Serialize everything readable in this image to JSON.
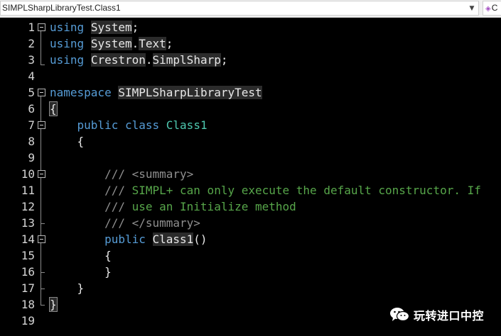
{
  "navbar": {
    "type_selector": "SIMPLSharpLibraryTest.Class1",
    "member_selector": "C"
  },
  "editor": {
    "lines": [
      {
        "n": "1",
        "tokens": [
          {
            "t": "using",
            "c": "kw"
          },
          {
            "t": " "
          },
          {
            "t": "System",
            "c": "hl"
          },
          {
            "t": ";"
          }
        ]
      },
      {
        "n": "2",
        "tokens": [
          {
            "t": "using",
            "c": "kw"
          },
          {
            "t": " "
          },
          {
            "t": "System",
            "c": "hl"
          },
          {
            "t": "."
          },
          {
            "t": "Text",
            "c": "hl"
          },
          {
            "t": ";"
          }
        ]
      },
      {
        "n": "3",
        "tokens": [
          {
            "t": "using",
            "c": "kw"
          },
          {
            "t": " "
          },
          {
            "t": "Crestron",
            "c": "hl"
          },
          {
            "t": "."
          },
          {
            "t": "SimplSharp",
            "c": "hl"
          },
          {
            "t": ";"
          }
        ]
      },
      {
        "n": "4",
        "tokens": []
      },
      {
        "n": "5",
        "tokens": [
          {
            "t": "namespace",
            "c": "kw"
          },
          {
            "t": " "
          },
          {
            "t": "SIMPLSharpLibraryTest",
            "c": "hl"
          }
        ]
      },
      {
        "n": "6",
        "tokens": [
          {
            "t": "{",
            "c": "brace-hl"
          }
        ]
      },
      {
        "n": "7",
        "tokens": [
          {
            "t": "    "
          },
          {
            "t": "public",
            "c": "kw"
          },
          {
            "t": " "
          },
          {
            "t": "class",
            "c": "kw"
          },
          {
            "t": " "
          },
          {
            "t": "Class1",
            "c": "ty"
          }
        ]
      },
      {
        "n": "8",
        "tokens": [
          {
            "t": "    {"
          }
        ]
      },
      {
        "n": "9",
        "tokens": []
      },
      {
        "n": "10",
        "tokens": [
          {
            "t": "        "
          },
          {
            "t": "/// <summary>",
            "c": "cmg"
          }
        ]
      },
      {
        "n": "11",
        "tokens": [
          {
            "t": "        "
          },
          {
            "t": "/// ",
            "c": "cmg"
          },
          {
            "t": "SIMPL+ can only execute the default constructor. If",
            "c": "cm"
          }
        ]
      },
      {
        "n": "12",
        "tokens": [
          {
            "t": "        "
          },
          {
            "t": "/// ",
            "c": "cmg"
          },
          {
            "t": "use an Initialize method",
            "c": "cm"
          }
        ]
      },
      {
        "n": "13",
        "tokens": [
          {
            "t": "        "
          },
          {
            "t": "/// </summary>",
            "c": "cmg"
          }
        ]
      },
      {
        "n": "14",
        "tokens": [
          {
            "t": "        "
          },
          {
            "t": "public",
            "c": "kw"
          },
          {
            "t": " "
          },
          {
            "t": "Class1",
            "c": "hl"
          },
          {
            "t": "()"
          }
        ]
      },
      {
        "n": "15",
        "tokens": [
          {
            "t": "        {"
          }
        ]
      },
      {
        "n": "16",
        "tokens": [
          {
            "t": "        }"
          }
        ]
      },
      {
        "n": "17",
        "tokens": [
          {
            "t": "    }"
          }
        ]
      },
      {
        "n": "18",
        "tokens": [
          {
            "t": "}",
            "c": "brace-hl"
          }
        ]
      },
      {
        "n": "19",
        "tokens": []
      }
    ]
  },
  "watermark": {
    "text": "玩转进口中控",
    "icon": "wechat-icon"
  }
}
